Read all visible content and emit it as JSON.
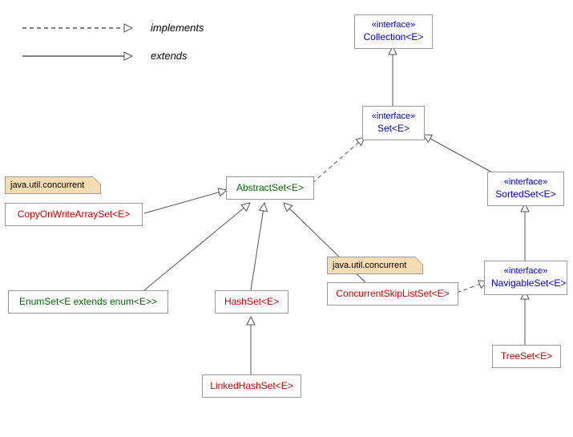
{
  "chart_data": {
    "type": "table",
    "title": "Java Set class hierarchy",
    "nodes": [
      {
        "name": "Collection<E>",
        "kind": "interface",
        "package": "java.util"
      },
      {
        "name": "Set<E>",
        "kind": "interface",
        "package": "java.util"
      },
      {
        "name": "SortedSet<E>",
        "kind": "interface",
        "package": "java.util"
      },
      {
        "name": "NavigableSet<E>",
        "kind": "interface",
        "package": "java.util"
      },
      {
        "name": "AbstractSet<E>",
        "kind": "abstract",
        "package": "java.util"
      },
      {
        "name": "EnumSet<E extends enum<E>>",
        "kind": "abstract",
        "package": "java.util"
      },
      {
        "name": "HashSet<E>",
        "kind": "concrete",
        "package": "java.util"
      },
      {
        "name": "LinkedHashSet<E>",
        "kind": "concrete",
        "package": "java.util"
      },
      {
        "name": "TreeSet<E>",
        "kind": "concrete",
        "package": "java.util"
      },
      {
        "name": "CopyOnWriteArraySet<E>",
        "kind": "concrete",
        "package": "java.util.concurrent"
      },
      {
        "name": "ConcurrentSkipListSet<E>",
        "kind": "concrete",
        "package": "java.util.concurrent"
      }
    ],
    "edges": [
      {
        "from": "Set<E>",
        "to": "Collection<E>",
        "relation": "extends"
      },
      {
        "from": "SortedSet<E>",
        "to": "Set<E>",
        "relation": "extends"
      },
      {
        "from": "NavigableSet<E>",
        "to": "SortedSet<E>",
        "relation": "extends"
      },
      {
        "from": "AbstractSet<E>",
        "to": "Set<E>",
        "relation": "implements"
      },
      {
        "from": "CopyOnWriteArraySet<E>",
        "to": "AbstractSet<E>",
        "relation": "extends"
      },
      {
        "from": "EnumSet<E extends enum<E>>",
        "to": "AbstractSet<E>",
        "relation": "extends"
      },
      {
        "from": "HashSet<E>",
        "to": "AbstractSet<E>",
        "relation": "extends"
      },
      {
        "from": "ConcurrentSkipListSet<E>",
        "to": "AbstractSet<E>",
        "relation": "extends"
      },
      {
        "from": "ConcurrentSkipListSet<E>",
        "to": "NavigableSet<E>",
        "relation": "implements"
      },
      {
        "from": "LinkedHashSet<E>",
        "to": "HashSet<E>",
        "relation": "extends"
      },
      {
        "from": "TreeSet<E>",
        "to": "NavigableSet<E>",
        "relation": "extends"
      }
    ]
  },
  "legend": {
    "implements": "implements",
    "extends": "extends"
  },
  "labels": {
    "interface_stereo": "«interface»",
    "collection": "Collection<E>",
    "set": "Set<E>",
    "sortedset": "SortedSet<E>",
    "navset": "NavigableSet<E>",
    "abstractset": "AbstractSet<E>",
    "enumset": "EnumSet<E extends enum<E>>",
    "hashset": "HashSet<E>",
    "linkedhashset": "LinkedHashSet<E>",
    "treeset": "TreeSet<E>",
    "cowarrayset": "CopyOnWriteArraySet<E>",
    "cskiplistset": "ConcurrentSkipListSet<E>"
  },
  "notes": {
    "concurrent_pkg": "java.util.concurrent"
  }
}
